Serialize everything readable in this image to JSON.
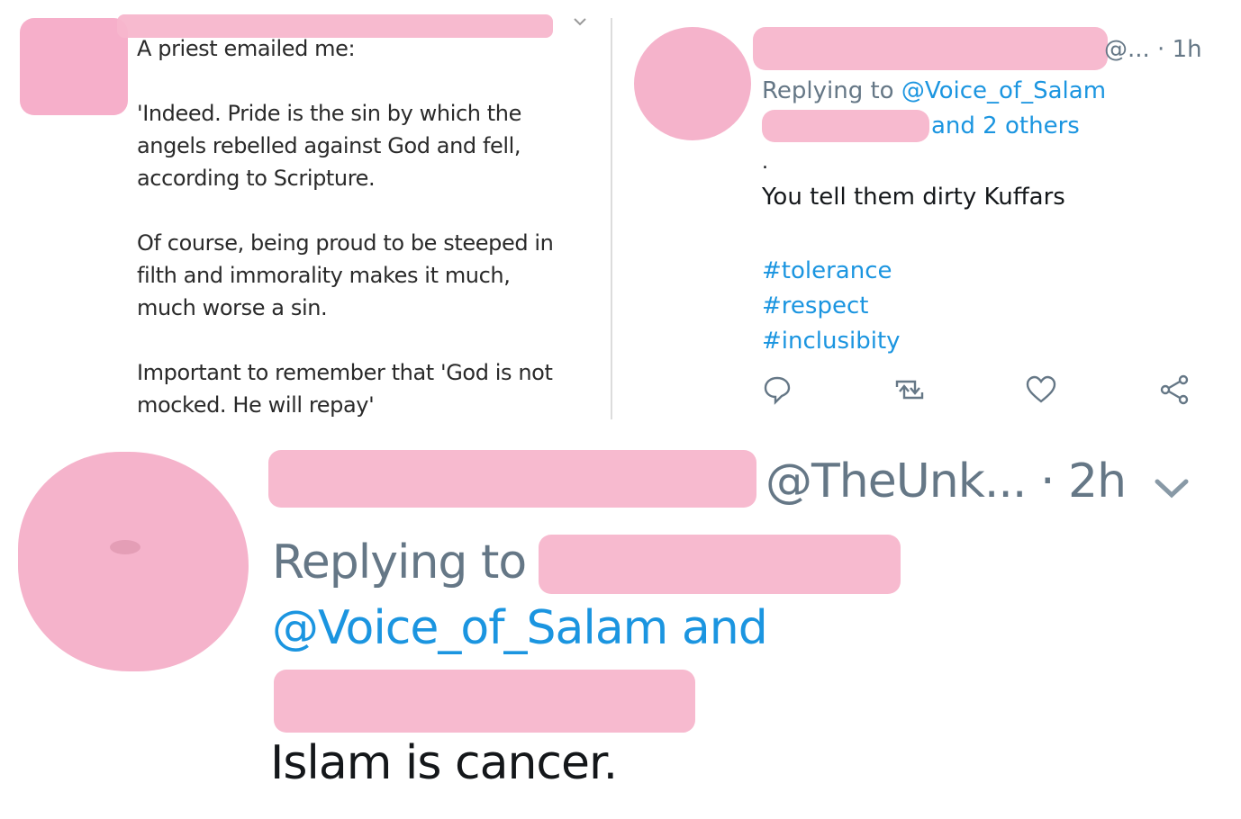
{
  "email": {
    "line_intro": "A priest emailed me:",
    "para1": "'Indeed. Pride is the sin by which the\nangels rebelled against God and fell,\naccording to Scripture.",
    "para2": "Of course, being proud to be steeped in\nfilth and immorality makes it much,\nmuch worse a sin.",
    "para3": "Important to remember that 'God is not\nmocked. He will repay'"
  },
  "tweet1": {
    "handle_time": "@...  · 1h",
    "replying_prefix": "Replying to ",
    "replying_handle": "@Voice_of_Salam",
    "replying_others": "and 2 others",
    "dot": ".",
    "body": "You tell them dirty Kuffars",
    "hashtags": [
      "#tolerance",
      "#respect",
      "#inclusibity"
    ],
    "actions": [
      "reply-icon",
      "retweet-icon",
      "like-icon",
      "share-icon"
    ]
  },
  "tweet2": {
    "handle_time": "@TheUnk... · 2h",
    "replying_prefix": "Replying to ",
    "replying_line2": "@Voice_of_Salam and",
    "body": "Islam is cancer."
  },
  "colors": {
    "link": "#1b95e0",
    "meta": "#657786",
    "redaction": "#f7b6cc"
  }
}
